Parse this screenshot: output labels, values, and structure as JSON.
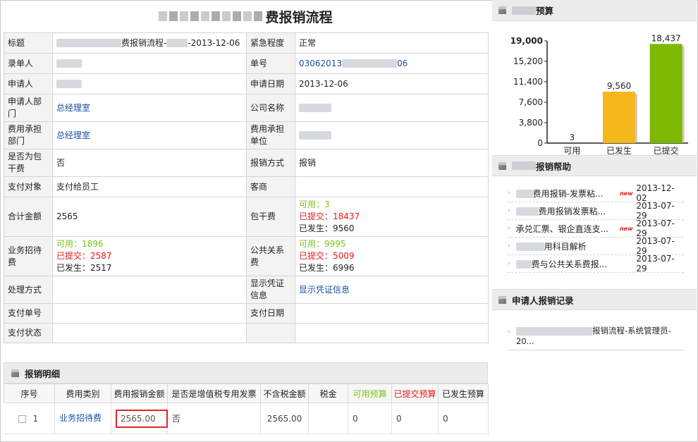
{
  "title": {
    "main": "费报销流程"
  },
  "form": {
    "rows": [
      {
        "l1": "标题",
        "v1": "费报销流程-",
        "v1b": "-2013-12-06",
        "l2": "紧急程度",
        "v2": "正常"
      },
      {
        "l1": "录单人",
        "v1": "",
        "l2": "单号",
        "v2a": "03062013",
        "v2b": "06"
      },
      {
        "l1": "申请人",
        "v1": "",
        "l2": "申请日期",
        "v2": "2013-12-06"
      },
      {
        "l1": "申请人部门",
        "v1": "总经理室",
        "l2": "公司名称",
        "v2": ""
      },
      {
        "l1": "费用承担部门",
        "v1": "总经理室",
        "l2": "费用承担单位",
        "v2": ""
      },
      {
        "l1": "是否为包干费",
        "v1": "否",
        "l2": "报销方式",
        "v2": "报销"
      },
      {
        "l1": "支付对象",
        "v1": "支付给员工",
        "l2": "客商",
        "v2": ""
      }
    ],
    "total": {
      "label": "合计金额",
      "value": "2565",
      "l2": "包干费",
      "avail": "可用：3",
      "submitted": "已提交：18437",
      "occurred": "已发生：9560"
    },
    "hospitality": {
      "label": "业务招待费",
      "avail": "可用：1896",
      "submitted": "已提交：2587",
      "occurred": "已发生：2517",
      "l2": "公共关系费",
      "avail2": "可用：9995",
      "submitted2": "已提交：5009",
      "occurred2": "已发生：6996"
    },
    "handling": {
      "label": "处理方式",
      "value": "",
      "l2": "显示凭证信息",
      "v2": "显示凭证信息"
    },
    "payno": {
      "label": "支付单号",
      "value": "",
      "l2": "支付日期",
      "v2": ""
    },
    "paystatus": {
      "label": "支付状态",
      "value": ""
    }
  },
  "detail": {
    "title": "报销明细",
    "columns": [
      "序号",
      "费用类别",
      "费用报销金额",
      "是否是增值税专用发票",
      "不含税金额",
      "税金",
      "可用预算",
      "已提交预算",
      "已发生预算"
    ],
    "rows": [
      {
        "no": "1",
        "category": "业务招待费",
        "amount": "2565.00",
        "vat": "否",
        "net": "2565.00",
        "tax": "",
        "avail": "0",
        "submitted": "0",
        "occurred": "0"
      }
    ]
  },
  "budget_panel": {
    "title": "预算"
  },
  "help_panel": {
    "title": "报销帮助",
    "items": [
      {
        "text": "费用报销-发票粘...",
        "new": true,
        "date": "2013-12-02"
      },
      {
        "text": "费用报销发票粘...",
        "new": false,
        "date": "2013-07-29"
      },
      {
        "text": "承兑汇票、银企直连支...",
        "new": true,
        "date": "2013-07-29"
      },
      {
        "text": "用科目解析",
        "new": false,
        "date": "2013-07-29"
      },
      {
        "text": "费与公共关系费报...",
        "new": false,
        "date": "2013-07-29"
      }
    ],
    "new_label": "new"
  },
  "records_panel": {
    "title": "申请人报销记录",
    "item": "报销流程-系统管理员-",
    "item_line2": "20..."
  },
  "colors": {
    "available": "#7cc21b",
    "submitted": "#e5191b",
    "occurred_bar": "#f5b81c",
    "submitted_bar": "#7fb800",
    "link": "#1d4fa3"
  },
  "chart_data": {
    "type": "bar",
    "categories": [
      "可用",
      "已发生",
      "已提交"
    ],
    "values": [
      3,
      9560,
      18437
    ],
    "ylim": [
      0,
      19000
    ],
    "yticks": [
      "0",
      "3,800",
      "7,600",
      "11,400",
      "15,200",
      "19,000"
    ],
    "ytick_values": [
      0,
      3800,
      7600,
      11400,
      15200,
      19000
    ],
    "value_labels": [
      "3",
      "9,560",
      "18,437"
    ],
    "colors": [
      "#4a7bd0",
      "#f5b81c",
      "#7fb800"
    ],
    "grid": false
  }
}
